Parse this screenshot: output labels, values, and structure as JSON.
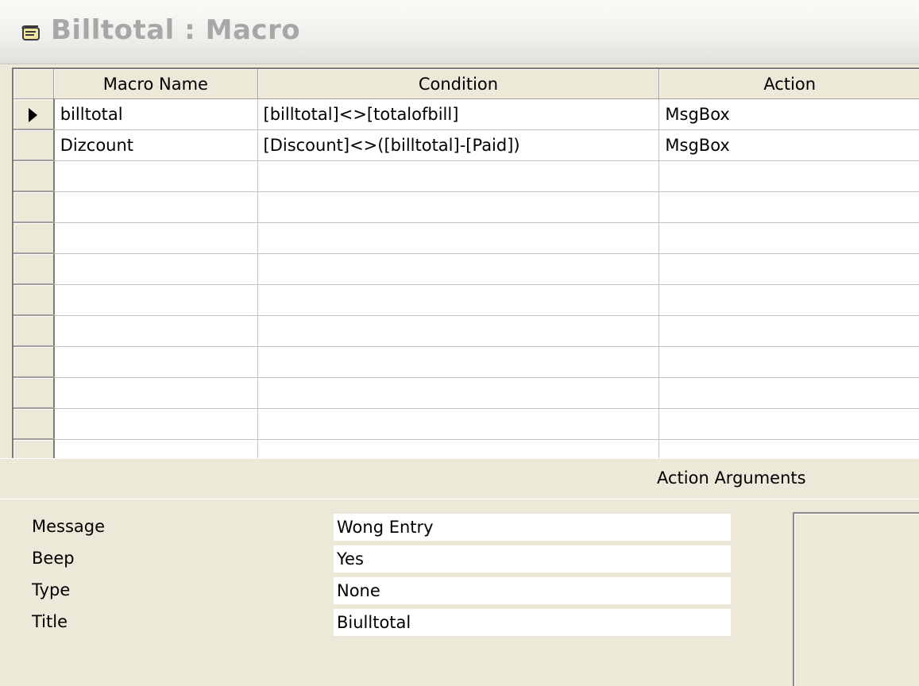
{
  "window": {
    "title": "Billtotal : Macro",
    "icon": "macro-scroll-icon"
  },
  "grid": {
    "columns": [
      "Macro Name",
      "Condition",
      "Action"
    ],
    "rows": [
      {
        "selected": true,
        "macro_name": "billtotal",
        "condition": "[billtotal]<>[totalofbill]",
        "action": "MsgBox"
      },
      {
        "selected": false,
        "macro_name": "Dizcount",
        "condition": "[Discount]<>([billtotal]-[Paid])",
        "action": "MsgBox"
      },
      {
        "selected": false,
        "macro_name": "",
        "condition": "",
        "action": ""
      },
      {
        "selected": false,
        "macro_name": "",
        "condition": "",
        "action": ""
      },
      {
        "selected": false,
        "macro_name": "",
        "condition": "",
        "action": ""
      },
      {
        "selected": false,
        "macro_name": "",
        "condition": "",
        "action": ""
      },
      {
        "selected": false,
        "macro_name": "",
        "condition": "",
        "action": ""
      },
      {
        "selected": false,
        "macro_name": "",
        "condition": "",
        "action": ""
      },
      {
        "selected": false,
        "macro_name": "",
        "condition": "",
        "action": ""
      },
      {
        "selected": false,
        "macro_name": "",
        "condition": "",
        "action": ""
      },
      {
        "selected": false,
        "macro_name": "",
        "condition": "",
        "action": ""
      },
      {
        "selected": false,
        "macro_name": "",
        "condition": "",
        "action": ""
      }
    ]
  },
  "action_arguments": {
    "header": "Action Arguments",
    "fields": [
      {
        "label": "Message",
        "value": "Wong Entry"
      },
      {
        "label": "Beep",
        "value": "Yes"
      },
      {
        "label": "Type",
        "value": "None"
      },
      {
        "label": "Title",
        "value": "Biulltotal"
      }
    ]
  }
}
